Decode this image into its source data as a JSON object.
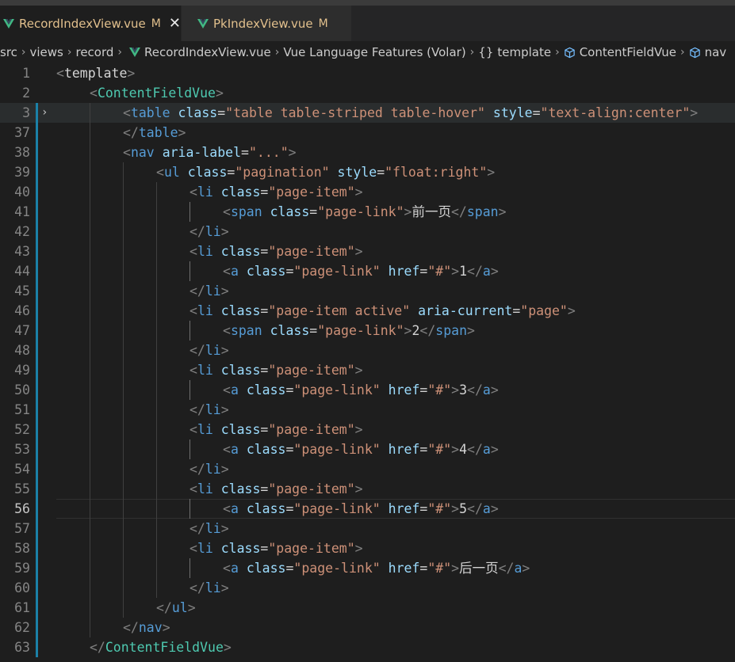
{
  "tabs": [
    {
      "label": "RecordIndexView.vue",
      "status": "M",
      "close": "✕",
      "icon": "vue-icon"
    },
    {
      "label": "PkIndexView.vue",
      "status": "M",
      "icon": "vue-icon"
    }
  ],
  "breadcrumbs": {
    "items": [
      "src",
      "views",
      "record",
      "RecordIndexView.vue",
      "Vue Language Features (Volar)",
      "template",
      "ContentFieldVue",
      "nav"
    ],
    "separator": "›",
    "braces": "{}"
  },
  "colors": {
    "background": "#1e1e1e",
    "tag": "#569cd6",
    "component": "#4ec9b0",
    "attribute": "#9cdcfe",
    "string": "#ce9178",
    "punctuation": "#808080",
    "text": "#d4d4d4",
    "modified_tab": "#e2c08d",
    "gutter_modified": "#1b81a8"
  },
  "editor": {
    "active_line": "56",
    "folded_line": "3",
    "lines": [
      {
        "n": "1",
        "i": 0,
        "seg": [
          [
            "p",
            "<"
          ],
          [
            "x",
            "template"
          ],
          [
            "p",
            ">"
          ]
        ]
      },
      {
        "n": "2",
        "i": 1,
        "seg": [
          [
            "p",
            "<"
          ],
          [
            "c",
            "ContentFieldVue"
          ],
          [
            "p",
            ">"
          ]
        ]
      },
      {
        "n": "3",
        "i": 2,
        "seg": [
          [
            "p",
            "<"
          ],
          [
            "t",
            "table"
          ],
          [
            "o",
            " "
          ],
          [
            "a",
            "class"
          ],
          [
            "o",
            "="
          ],
          [
            "s",
            "\"table table-striped table-hover\""
          ],
          [
            "o",
            " "
          ],
          [
            "a",
            "style"
          ],
          [
            "o",
            "="
          ],
          [
            "s",
            "\"text-align:center\""
          ],
          [
            "p",
            ">"
          ]
        ]
      },
      {
        "n": "37",
        "i": 2,
        "seg": [
          [
            "p",
            "</"
          ],
          [
            "t",
            "table"
          ],
          [
            "p",
            ">"
          ]
        ]
      },
      {
        "n": "38",
        "i": 2,
        "seg": [
          [
            "p",
            "<"
          ],
          [
            "t",
            "nav"
          ],
          [
            "o",
            " "
          ],
          [
            "a",
            "aria-label"
          ],
          [
            "o",
            "="
          ],
          [
            "s",
            "\"...\""
          ],
          [
            "p",
            ">"
          ]
        ]
      },
      {
        "n": "39",
        "i": 3,
        "seg": [
          [
            "p",
            "<"
          ],
          [
            "t",
            "ul"
          ],
          [
            "o",
            " "
          ],
          [
            "a",
            "class"
          ],
          [
            "o",
            "="
          ],
          [
            "s",
            "\"pagination\""
          ],
          [
            "o",
            " "
          ],
          [
            "a",
            "style"
          ],
          [
            "o",
            "="
          ],
          [
            "s",
            "\"float:right\""
          ],
          [
            "p",
            ">"
          ]
        ]
      },
      {
        "n": "40",
        "i": 4,
        "seg": [
          [
            "p",
            "<"
          ],
          [
            "t",
            "li"
          ],
          [
            "o",
            " "
          ],
          [
            "a",
            "class"
          ],
          [
            "o",
            "="
          ],
          [
            "s",
            "\"page-item\""
          ],
          [
            "p",
            ">"
          ]
        ]
      },
      {
        "n": "41",
        "i": 5,
        "seg": [
          [
            "p",
            "<"
          ],
          [
            "t",
            "span"
          ],
          [
            "o",
            " "
          ],
          [
            "a",
            "class"
          ],
          [
            "o",
            "="
          ],
          [
            "s",
            "\"page-link\""
          ],
          [
            "p",
            ">"
          ],
          [
            "x",
            "前一页"
          ],
          [
            "p",
            "</"
          ],
          [
            "t",
            "span"
          ],
          [
            "p",
            ">"
          ]
        ]
      },
      {
        "n": "42",
        "i": 4,
        "seg": [
          [
            "p",
            "</"
          ],
          [
            "t",
            "li"
          ],
          [
            "p",
            ">"
          ]
        ]
      },
      {
        "n": "43",
        "i": 4,
        "seg": [
          [
            "p",
            "<"
          ],
          [
            "t",
            "li"
          ],
          [
            "o",
            " "
          ],
          [
            "a",
            "class"
          ],
          [
            "o",
            "="
          ],
          [
            "s",
            "\"page-item\""
          ],
          [
            "p",
            ">"
          ]
        ]
      },
      {
        "n": "44",
        "i": 5,
        "seg": [
          [
            "p",
            "<"
          ],
          [
            "t",
            "a"
          ],
          [
            "o",
            " "
          ],
          [
            "a",
            "class"
          ],
          [
            "o",
            "="
          ],
          [
            "s",
            "\"page-link\""
          ],
          [
            "o",
            " "
          ],
          [
            "a",
            "href"
          ],
          [
            "o",
            "="
          ],
          [
            "s",
            "\"#\""
          ],
          [
            "p",
            ">"
          ],
          [
            "x",
            "1"
          ],
          [
            "p",
            "</"
          ],
          [
            "t",
            "a"
          ],
          [
            "p",
            ">"
          ]
        ]
      },
      {
        "n": "45",
        "i": 4,
        "seg": [
          [
            "p",
            "</"
          ],
          [
            "t",
            "li"
          ],
          [
            "p",
            ">"
          ]
        ]
      },
      {
        "n": "46",
        "i": 4,
        "seg": [
          [
            "p",
            "<"
          ],
          [
            "t",
            "li"
          ],
          [
            "o",
            " "
          ],
          [
            "a",
            "class"
          ],
          [
            "o",
            "="
          ],
          [
            "s",
            "\"page-item active\""
          ],
          [
            "o",
            " "
          ],
          [
            "a",
            "aria-current"
          ],
          [
            "o",
            "="
          ],
          [
            "s",
            "\"page\""
          ],
          [
            "p",
            ">"
          ]
        ]
      },
      {
        "n": "47",
        "i": 5,
        "seg": [
          [
            "p",
            "<"
          ],
          [
            "t",
            "span"
          ],
          [
            "o",
            " "
          ],
          [
            "a",
            "class"
          ],
          [
            "o",
            "="
          ],
          [
            "s",
            "\"page-link\""
          ],
          [
            "p",
            ">"
          ],
          [
            "x",
            "2"
          ],
          [
            "p",
            "</"
          ],
          [
            "t",
            "span"
          ],
          [
            "p",
            ">"
          ]
        ]
      },
      {
        "n": "48",
        "i": 4,
        "seg": [
          [
            "p",
            "</"
          ],
          [
            "t",
            "li"
          ],
          [
            "p",
            ">"
          ]
        ]
      },
      {
        "n": "49",
        "i": 4,
        "seg": [
          [
            "p",
            "<"
          ],
          [
            "t",
            "li"
          ],
          [
            "o",
            " "
          ],
          [
            "a",
            "class"
          ],
          [
            "o",
            "="
          ],
          [
            "s",
            "\"page-item\""
          ],
          [
            "p",
            ">"
          ]
        ]
      },
      {
        "n": "50",
        "i": 5,
        "seg": [
          [
            "p",
            "<"
          ],
          [
            "t",
            "a"
          ],
          [
            "o",
            " "
          ],
          [
            "a",
            "class"
          ],
          [
            "o",
            "="
          ],
          [
            "s",
            "\"page-link\""
          ],
          [
            "o",
            " "
          ],
          [
            "a",
            "href"
          ],
          [
            "o",
            "="
          ],
          [
            "s",
            "\"#\""
          ],
          [
            "p",
            ">"
          ],
          [
            "x",
            "3"
          ],
          [
            "p",
            "</"
          ],
          [
            "t",
            "a"
          ],
          [
            "p",
            ">"
          ]
        ]
      },
      {
        "n": "51",
        "i": 4,
        "seg": [
          [
            "p",
            "</"
          ],
          [
            "t",
            "li"
          ],
          [
            "p",
            ">"
          ]
        ]
      },
      {
        "n": "52",
        "i": 4,
        "seg": [
          [
            "p",
            "<"
          ],
          [
            "t",
            "li"
          ],
          [
            "o",
            " "
          ],
          [
            "a",
            "class"
          ],
          [
            "o",
            "="
          ],
          [
            "s",
            "\"page-item\""
          ],
          [
            "p",
            ">"
          ]
        ]
      },
      {
        "n": "53",
        "i": 5,
        "seg": [
          [
            "p",
            "<"
          ],
          [
            "t",
            "a"
          ],
          [
            "o",
            " "
          ],
          [
            "a",
            "class"
          ],
          [
            "o",
            "="
          ],
          [
            "s",
            "\"page-link\""
          ],
          [
            "o",
            " "
          ],
          [
            "a",
            "href"
          ],
          [
            "o",
            "="
          ],
          [
            "s",
            "\"#\""
          ],
          [
            "p",
            ">"
          ],
          [
            "x",
            "4"
          ],
          [
            "p",
            "</"
          ],
          [
            "t",
            "a"
          ],
          [
            "p",
            ">"
          ]
        ]
      },
      {
        "n": "54",
        "i": 4,
        "seg": [
          [
            "p",
            "</"
          ],
          [
            "t",
            "li"
          ],
          [
            "p",
            ">"
          ]
        ]
      },
      {
        "n": "55",
        "i": 4,
        "seg": [
          [
            "p",
            "<"
          ],
          [
            "t",
            "li"
          ],
          [
            "o",
            " "
          ],
          [
            "a",
            "class"
          ],
          [
            "o",
            "="
          ],
          [
            "s",
            "\"page-item\""
          ],
          [
            "p",
            ">"
          ]
        ]
      },
      {
        "n": "56",
        "i": 5,
        "seg": [
          [
            "p",
            "<"
          ],
          [
            "t",
            "a"
          ],
          [
            "o",
            " "
          ],
          [
            "a",
            "class"
          ],
          [
            "o",
            "="
          ],
          [
            "s",
            "\"page-link\""
          ],
          [
            "o",
            " "
          ],
          [
            "a",
            "href"
          ],
          [
            "o",
            "="
          ],
          [
            "s",
            "\"#\""
          ],
          [
            "p",
            ">"
          ],
          [
            "x",
            "5"
          ],
          [
            "p",
            "</"
          ],
          [
            "t",
            "a"
          ],
          [
            "p",
            ">"
          ]
        ]
      },
      {
        "n": "57",
        "i": 4,
        "seg": [
          [
            "p",
            "</"
          ],
          [
            "t",
            "li"
          ],
          [
            "p",
            ">"
          ]
        ]
      },
      {
        "n": "58",
        "i": 4,
        "seg": [
          [
            "p",
            "<"
          ],
          [
            "t",
            "li"
          ],
          [
            "o",
            " "
          ],
          [
            "a",
            "class"
          ],
          [
            "o",
            "="
          ],
          [
            "s",
            "\"page-item\""
          ],
          [
            "p",
            ">"
          ]
        ]
      },
      {
        "n": "59",
        "i": 5,
        "seg": [
          [
            "p",
            "<"
          ],
          [
            "t",
            "a"
          ],
          [
            "o",
            " "
          ],
          [
            "a",
            "class"
          ],
          [
            "o",
            "="
          ],
          [
            "s",
            "\"page-link\""
          ],
          [
            "o",
            " "
          ],
          [
            "a",
            "href"
          ],
          [
            "o",
            "="
          ],
          [
            "s",
            "\"#\""
          ],
          [
            "p",
            ">"
          ],
          [
            "x",
            "后一页"
          ],
          [
            "p",
            "</"
          ],
          [
            "t",
            "a"
          ],
          [
            "p",
            ">"
          ]
        ]
      },
      {
        "n": "60",
        "i": 4,
        "seg": [
          [
            "p",
            "</"
          ],
          [
            "t",
            "li"
          ],
          [
            "p",
            ">"
          ]
        ]
      },
      {
        "n": "61",
        "i": 3,
        "seg": [
          [
            "p",
            "</"
          ],
          [
            "t",
            "ul"
          ],
          [
            "p",
            ">"
          ]
        ]
      },
      {
        "n": "62",
        "i": 2,
        "seg": [
          [
            "p",
            "</"
          ],
          [
            "t",
            "nav"
          ],
          [
            "p",
            ">"
          ]
        ]
      },
      {
        "n": "63",
        "i": 1,
        "seg": [
          [
            "p",
            "</"
          ],
          [
            "c",
            "ContentFieldVue"
          ],
          [
            "p",
            ">"
          ]
        ]
      }
    ]
  }
}
